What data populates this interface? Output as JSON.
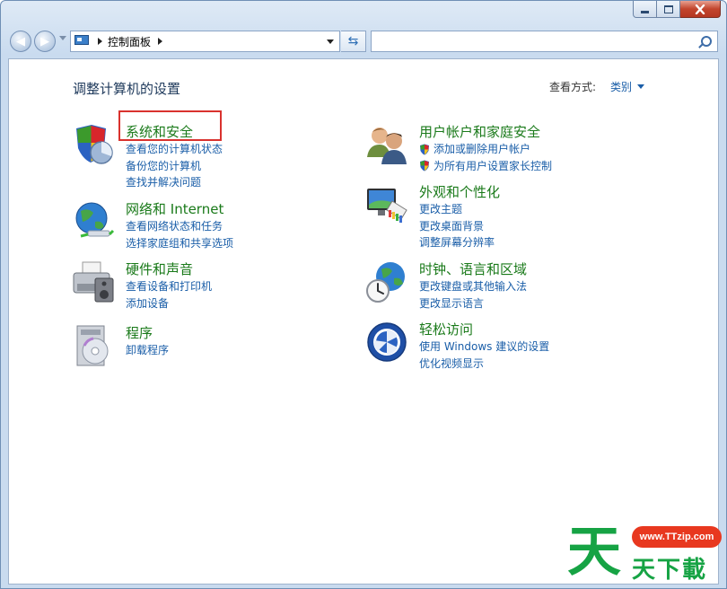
{
  "address": {
    "path": "控制面板"
  },
  "search": {
    "placeholder": ""
  },
  "page": {
    "title": "调整计算机的设置",
    "view_by_label": "查看方式:",
    "view_by_value": "类别"
  },
  "categories": {
    "system_security": {
      "title": "系统和安全",
      "links": [
        "查看您的计算机状态",
        "备份您的计算机",
        "查找并解决问题"
      ]
    },
    "network": {
      "title": "网络和 Internet",
      "links": [
        "查看网络状态和任务",
        "选择家庭组和共享选项"
      ]
    },
    "hardware": {
      "title": "硬件和声音",
      "links": [
        "查看设备和打印机",
        "添加设备"
      ]
    },
    "programs": {
      "title": "程序",
      "links": [
        "卸载程序"
      ]
    },
    "users": {
      "title": "用户帐户和家庭安全",
      "links": [
        "添加或删除用户帐户",
        "为所有用户设置家长控制"
      ]
    },
    "appearance": {
      "title": "外观和个性化",
      "links": [
        "更改主题",
        "更改桌面背景",
        "调整屏幕分辨率"
      ]
    },
    "clock": {
      "title": "时钟、语言和区域",
      "links": [
        "更改键盘或其他输入法",
        "更改显示语言"
      ]
    },
    "ease": {
      "title": "轻松访问",
      "links": [
        "使用 Windows 建议的设置",
        "优化视频显示"
      ]
    }
  },
  "watermark": {
    "url": "www.TTzip.com",
    "big": "天",
    "small": "天下載"
  },
  "colors": {
    "title_green": "#1a7a1a",
    "link_blue": "#1a5ea8",
    "highlight_red": "#d9322e"
  }
}
